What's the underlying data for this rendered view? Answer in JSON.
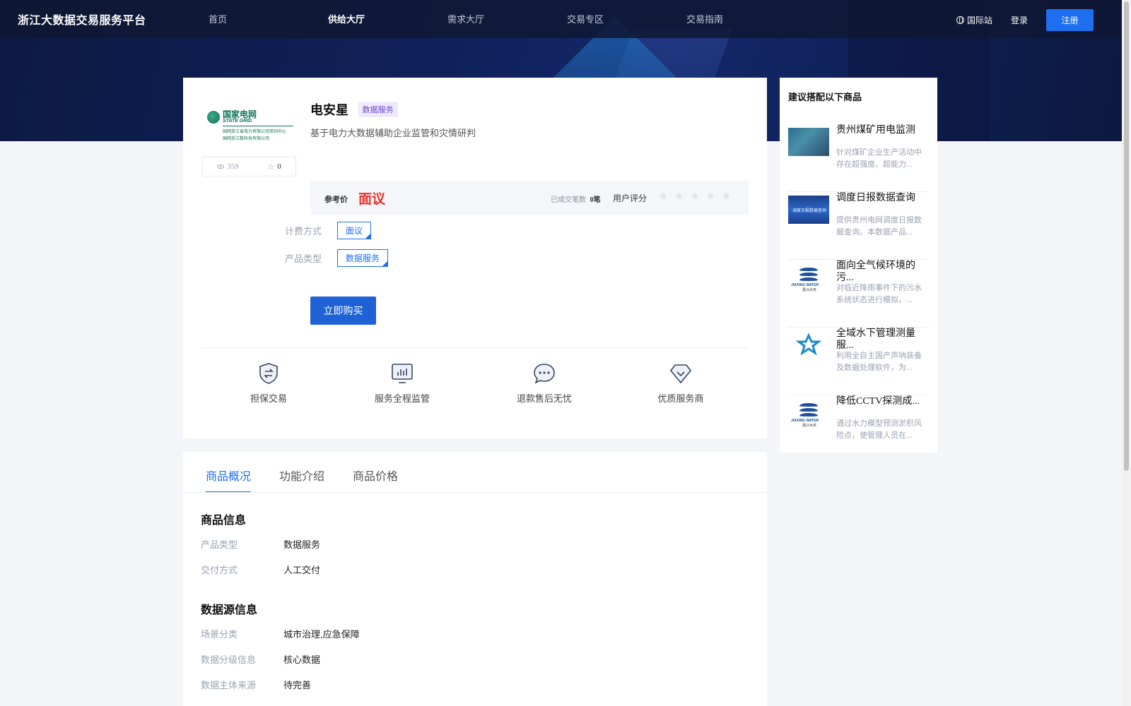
{
  "nav": {
    "logo": "浙江大数据交易服务平台",
    "menu": [
      {
        "label": "首页",
        "active": false
      },
      {
        "label": "供给大厅",
        "active": true
      },
      {
        "label": "需求大厅",
        "active": false
      },
      {
        "label": "交易专区",
        "active": false
      },
      {
        "label": "交易指南",
        "active": false
      }
    ],
    "intl_label": "国际站",
    "login_label": "登录",
    "register_label": "注册"
  },
  "product": {
    "provider_logo": {
      "name_cn": "国家电网",
      "name_en": "STATE GRID",
      "sub_line1": "国网浙江省电力有限公司双创中心",
      "sub_line2": "国网浙江数科技有限公司"
    },
    "views": "359",
    "favorites": "0",
    "name": "电安星",
    "tag": "数据服务",
    "description": "基于电力大数据辅助企业监管和灾情研判",
    "price_label": "参考价",
    "price_value": "面议",
    "deals_label": "已成交笔数",
    "deals_value": "0笔",
    "rating_label": "用户评分",
    "rating": 0,
    "rating_max": 5,
    "billing_label": "计费方式",
    "billing_value": "面议",
    "type_label": "产品类型",
    "type_value": "数据服务",
    "buy_label": "立即购买"
  },
  "features": [
    {
      "label": "担保交易",
      "icon": "shield-exchange-icon"
    },
    {
      "label": "服务全程监管",
      "icon": "monitor-chart-icon"
    },
    {
      "label": "退款售后无忧",
      "icon": "chat-bubble-icon"
    },
    {
      "label": "优质服务商",
      "icon": "diamond-icon"
    }
  ],
  "tabs": [
    {
      "label": "商品概况",
      "active": true
    },
    {
      "label": "功能介绍",
      "active": false
    },
    {
      "label": "商品价格",
      "active": false
    }
  ],
  "product_info": {
    "title": "商品信息",
    "rows": [
      {
        "k": "产品类型",
        "v": "数据服务"
      },
      {
        "k": "交付方式",
        "v": "人工交付"
      }
    ]
  },
  "source_info": {
    "title": "数据源信息",
    "rows": [
      {
        "k": "场景分类",
        "v": "城市治理,应急保障"
      },
      {
        "k": "数据分级信息",
        "v": "核心数据"
      },
      {
        "k": "数据主体来源",
        "v": "待完善"
      }
    ]
  },
  "sidebar": {
    "title": "建议搭配以下商品",
    "items": [
      {
        "title": "贵州煤矿用电监测",
        "desc": "针对煤矿企业生产活动中存在超强度、超能力...",
        "thumb": "map-thumbnail"
      },
      {
        "title": "调度日报数据查询",
        "desc": "提供贵州电网调度日报数据查询。本数据产品...",
        "thumb": "report-thumbnail",
        "thumb_text": "调度日报数据查询"
      },
      {
        "title": "面向全气候环境的污...",
        "desc": "对临近降雨事件下的污水系统状态进行模拟，...",
        "thumb": "jiaxing-water-logo",
        "logo_en": "JIAXING WATER",
        "logo_cn": "嘉兴水务"
      },
      {
        "title": "全域水下管理测量服...",
        "desc": "利用全自主国产声呐装备及数据处理软件，为...",
        "thumb": "star-logo"
      },
      {
        "title": "降低CCTV探测成...",
        "desc": "通过水力模型预测淤积风险点，使管理人员在...",
        "thumb": "jiaxing-water-logo",
        "logo_en": "JIAXING WATER",
        "logo_cn": "嘉兴水务"
      }
    ]
  }
}
